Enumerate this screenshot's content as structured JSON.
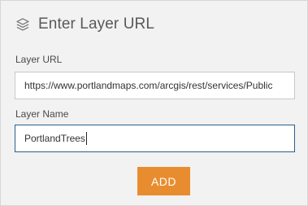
{
  "header": {
    "title": "Enter Layer URL",
    "icon": "layers-icon"
  },
  "form": {
    "url_label": "Layer URL",
    "url_value": "https://www.portlandmaps.com/arcgis/rest/services/Public",
    "name_label": "Layer Name",
    "name_value": "PortlandTrees"
  },
  "actions": {
    "add_label": "ADD"
  },
  "colors": {
    "accent": "#e88d2f",
    "focus_border": "#2b5f8e",
    "panel_bg": "#f2f2f2"
  }
}
